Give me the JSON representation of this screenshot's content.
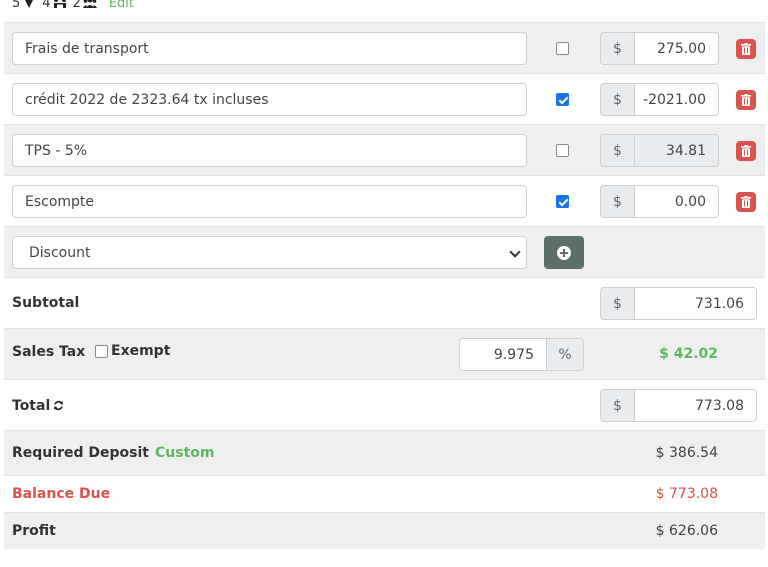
{
  "header": {
    "count_a": "5",
    "count_b": "4",
    "count_c": "2",
    "edit_label": "Edit"
  },
  "line_items": [
    {
      "description": "Frais de transport",
      "checked": false,
      "currency": "$",
      "amount": "275.00",
      "readonly": false
    },
    {
      "description": "crédit 2022 de 2323.64 tx incluses",
      "checked": true,
      "currency": "$",
      "amount": "-2021.00",
      "readonly": false
    },
    {
      "description": "TPS - 5%",
      "checked": false,
      "currency": "$",
      "amount": "34.81",
      "readonly": true
    },
    {
      "description": "Escompte",
      "checked": true,
      "currency": "$",
      "amount": "0.00",
      "readonly": false
    }
  ],
  "add_row": {
    "selected_option": "Discount"
  },
  "subtotal": {
    "label": "Subtotal",
    "currency": "$",
    "value": "731.06"
  },
  "sales_tax": {
    "label": "Sales Tax",
    "exempt_label": "Exempt",
    "rate": "9.975",
    "rate_unit": "%",
    "amount": "$ 42.02"
  },
  "total": {
    "label": "Total",
    "currency": "$",
    "value": "773.08"
  },
  "deposit": {
    "label": "Required Deposit",
    "mode": "Custom",
    "amount": "$ 386.54"
  },
  "balance": {
    "label": "Balance Due",
    "amount": "$ 773.08"
  },
  "profit": {
    "label": "Profit",
    "amount": "$ 626.06"
  },
  "colors": {
    "accent_green": "#5cb85c",
    "danger_red": "#d9534f",
    "add_button": "#5d7068",
    "checkbox_blue": "#1a73e8"
  }
}
